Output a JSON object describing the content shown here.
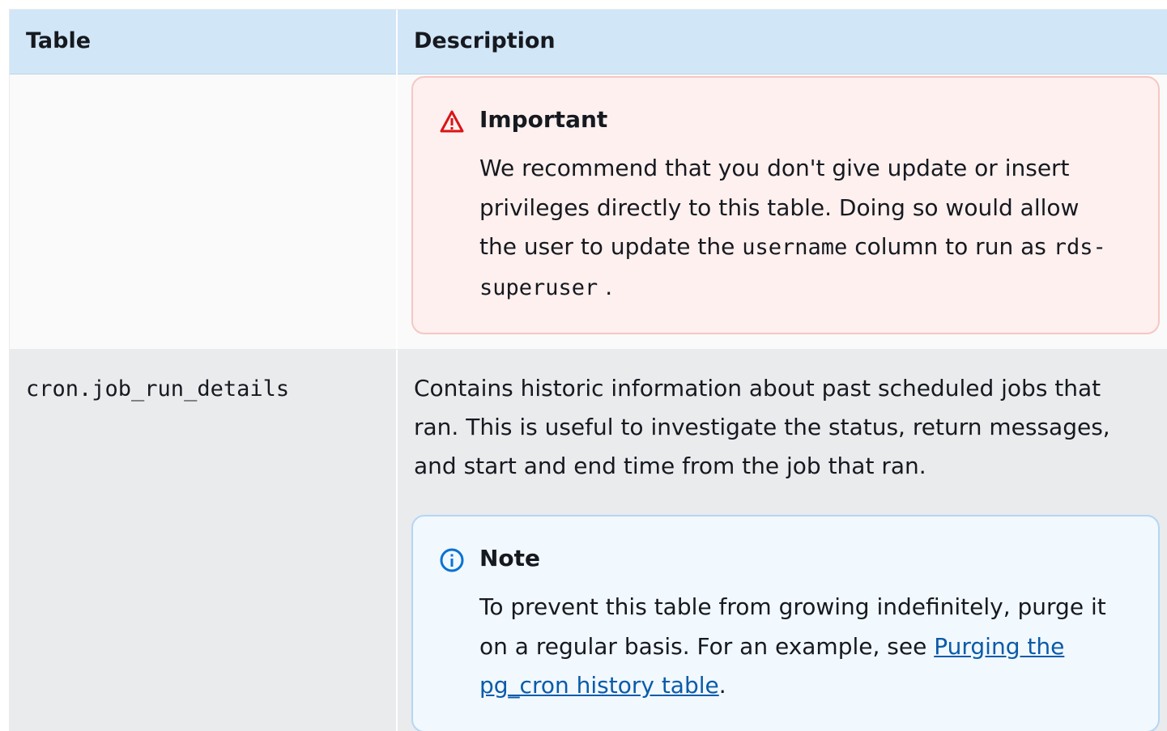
{
  "header": {
    "col_table": "Table",
    "col_description": "Description"
  },
  "rows": [
    {
      "table_name": "",
      "callout": {
        "type": "important",
        "icon": "warning-triangle-icon",
        "title": "Important",
        "text_1": "We recommend that you don't give update or insert privileges directly to this table. Doing so would allow the user to update the ",
        "code_1": "username",
        "text_2": " column to run as ",
        "code_2": "rds-superuser",
        "text_3": " ."
      }
    },
    {
      "table_name": "cron.job_run_details",
      "description": "Contains historic information about past scheduled jobs that ran. This is useful to investigate the status, return messages, and start and end time from the job that ran.",
      "callout": {
        "type": "note",
        "icon": "info-circle-icon",
        "title": "Note",
        "text_1": "To prevent this table from growing indefinitely, purge it on a regular basis. For an example, see ",
        "link_text": "Purging the pg_cron history table",
        "text_2": "."
      }
    }
  ],
  "colors": {
    "header_bg": "#d1e6f7",
    "warning_bg": "#fdf0ef",
    "warning_border": "#f6c7c3",
    "warning_icon": "#d91515",
    "note_bg": "#f1f8fe",
    "note_border": "#b5d6f4",
    "note_icon": "#0972d3",
    "link": "#0a5ba9"
  }
}
